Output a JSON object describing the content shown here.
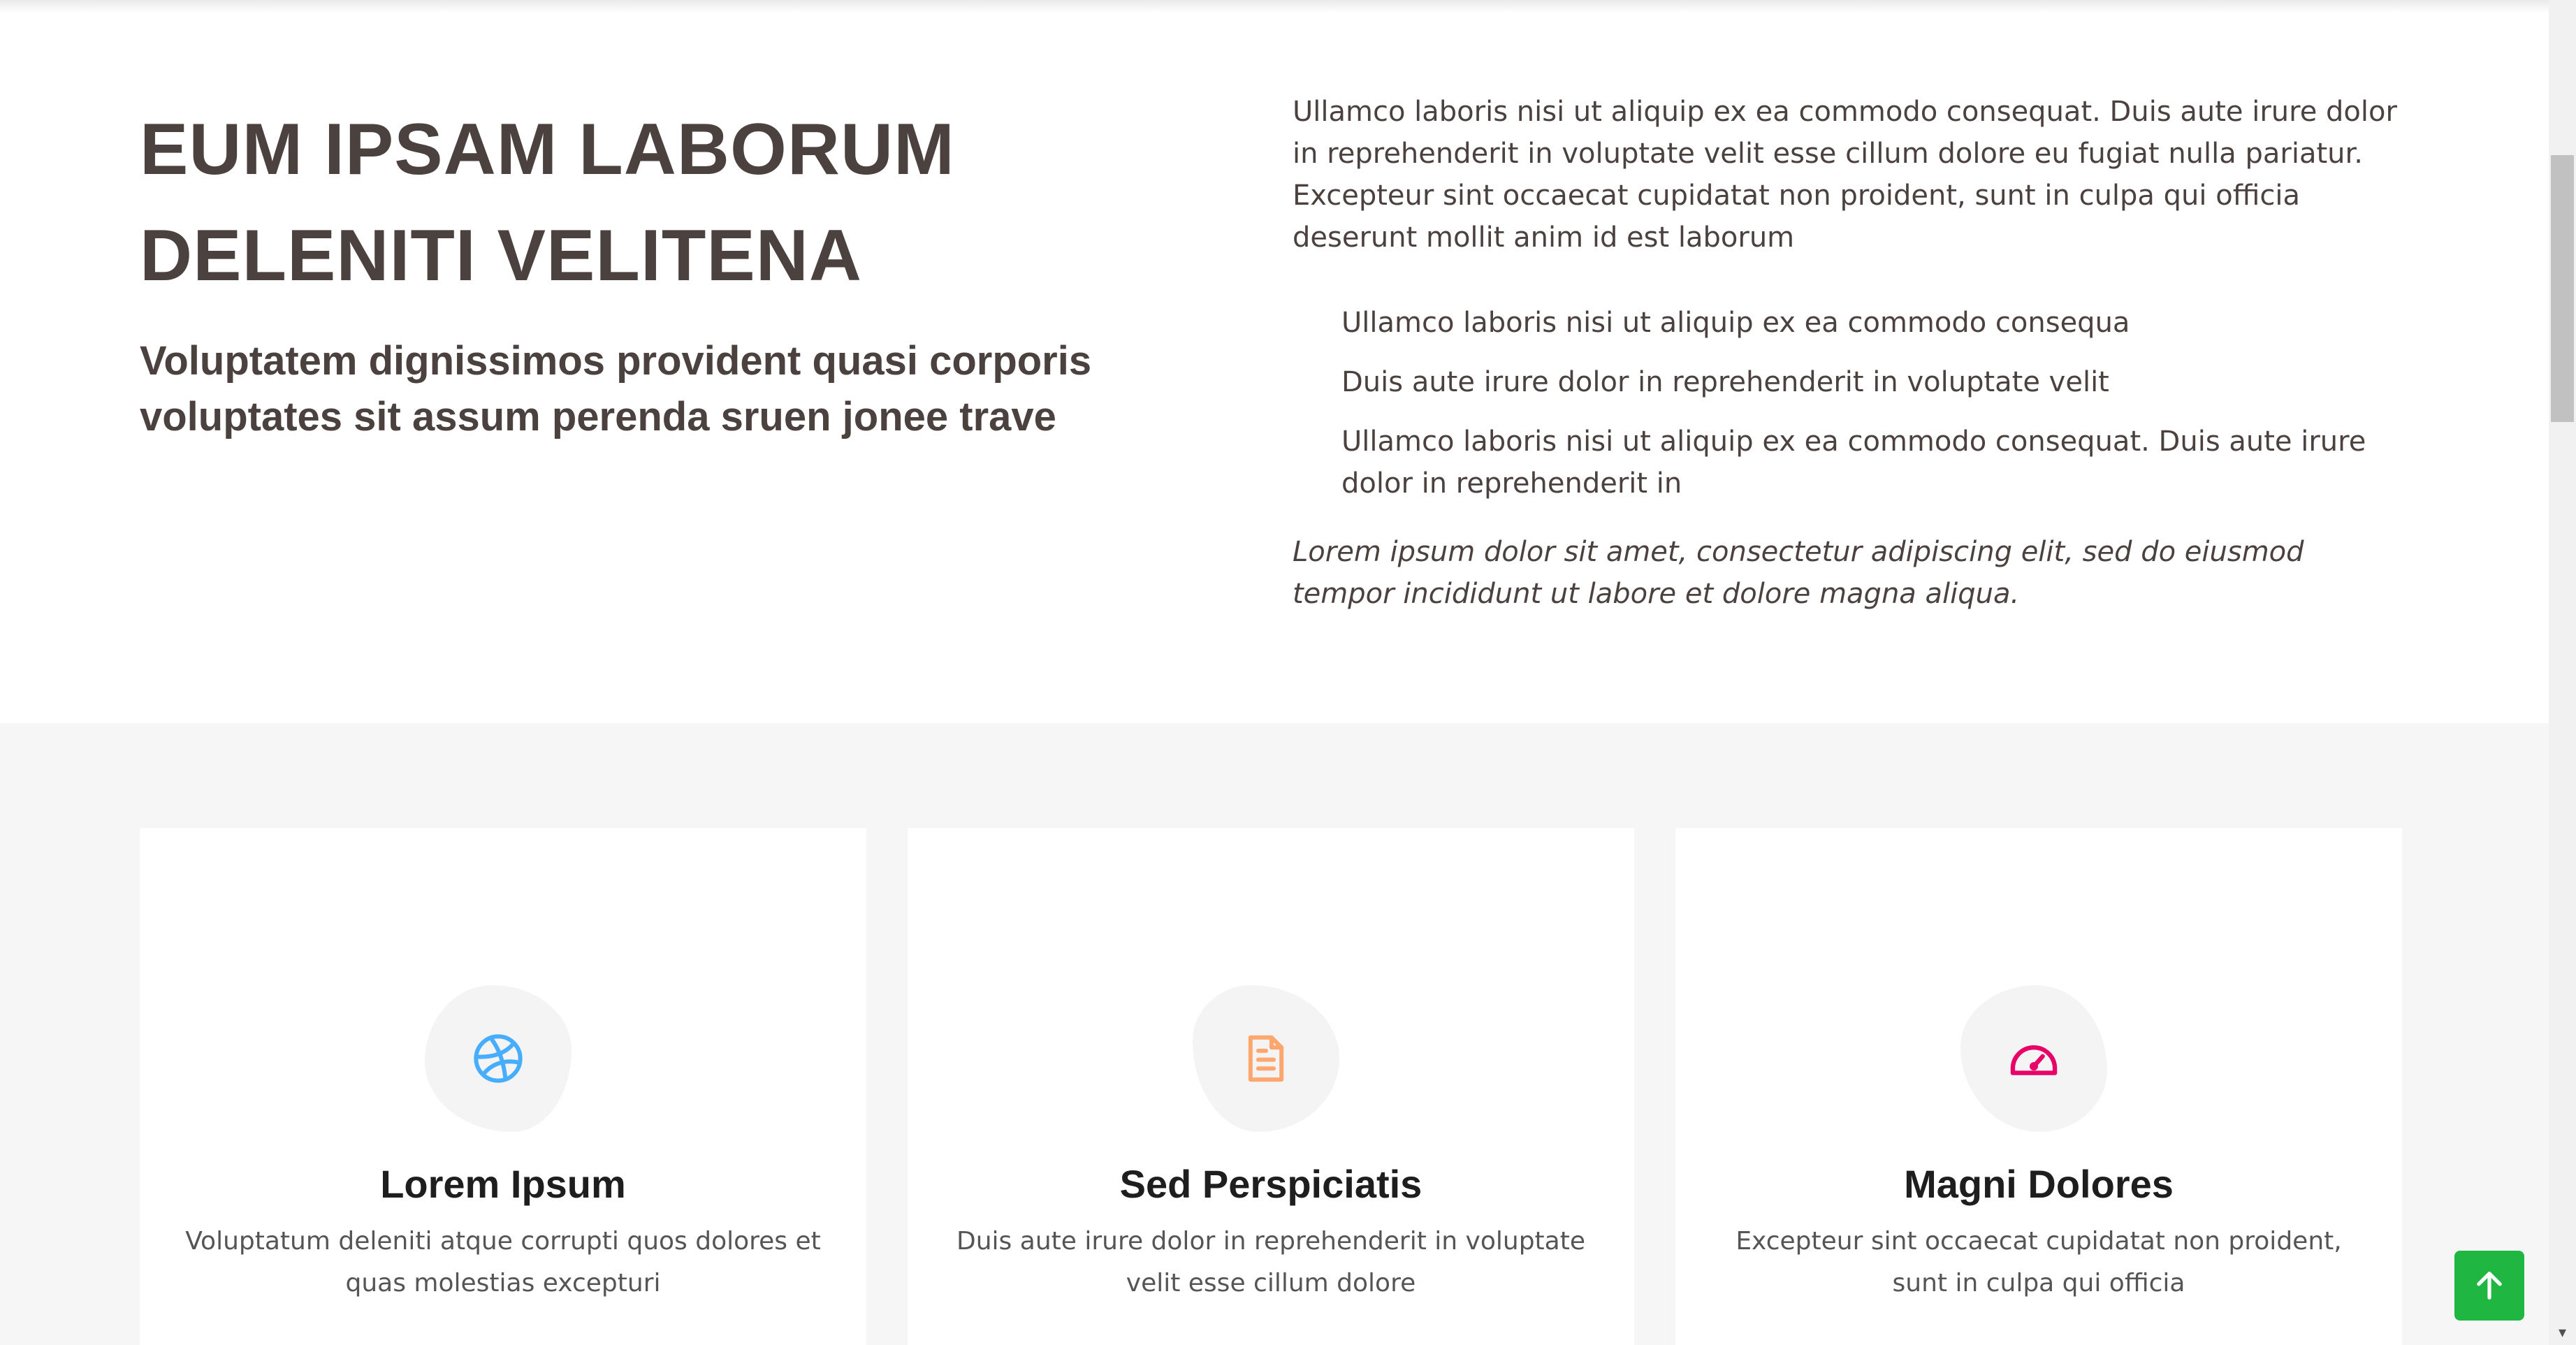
{
  "about": {
    "title": "EUM IPSAM LABORUM DELENITI VELITENA",
    "subtitle": "Voluptatem dignissimos provident quasi corporis voluptates sit assum perenda sruen jonee trave",
    "paragraph": "Ullamco laboris nisi ut aliquip ex ea commodo consequat. Duis aute irure dolor in reprehenderit in voluptate velit esse cillum dolore eu fugiat nulla pariatur. Excepteur sint occaecat cupidatat non proident, sunt in culpa qui officia deserunt mollit anim id est laborum",
    "list": [
      "Ullamco laboris nisi ut aliquip ex ea commodo consequa",
      "Duis aute irure dolor in reprehenderit in voluptate velit",
      "Ullamco laboris nisi ut aliquip ex ea commodo consequat. Duis aute irure dolor in reprehenderit in"
    ],
    "italic": "Lorem ipsum dolor sit amet, consectetur adipiscing elit, sed do eiusmod tempor incididunt ut labore et dolore magna aliqua."
  },
  "services": [
    {
      "title": "Lorem Ipsum",
      "desc": "Voluptatum deleniti atque corrupti quos dolores et quas molestias excepturi",
      "icon": "dribbble-icon",
      "color": "#47aeff"
    },
    {
      "title": "Sed Perspiciatis",
      "desc": "Duis aute irure dolor in reprehenderit in voluptate velit esse cillum dolore",
      "icon": "file-text-icon",
      "color": "#ffa76e"
    },
    {
      "title": "Magni Dolores",
      "desc": "Excepteur sint occaecat cupidatat non proident, sunt in culpa qui officia",
      "icon": "speedometer-icon",
      "color": "#e80368"
    }
  ],
  "colors": {
    "heading": "#4b4240",
    "services_bg": "#f6f6f6",
    "back_to_top": "#1fb741"
  },
  "back_to_top": {
    "icon": "arrow-up-icon"
  }
}
